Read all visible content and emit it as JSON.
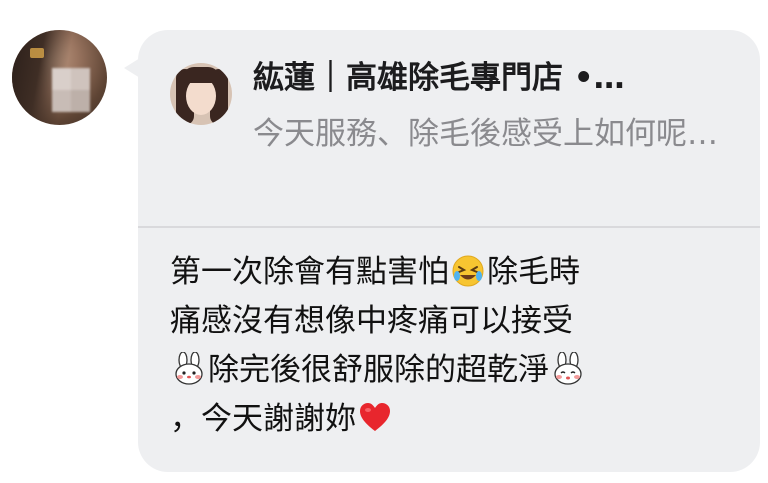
{
  "sender": {
    "avatar_icon": "blurred-profile-photo"
  },
  "quote": {
    "title": "紘蓮｜高雄除毛專門店 •…",
    "text": "今天服務、除毛後感受上如何呢…"
  },
  "message": {
    "line1_a": "第一次除會有點害怕",
    "line1_b": "除毛時",
    "line2": "痛感沒有想像中疼痛可以接受",
    "line3_a": "除完後很舒服除的超乾淨",
    "line4_a": "，今天謝謝妳",
    "emoji_laugh": "rolling-laughing-emoji",
    "emoji_bunny": "bunny-sticker-emoji",
    "emoji_heart": "red-heart-emoji"
  },
  "colors": {
    "bubble": "#eeeff1",
    "quote_text": "#8a8a8e",
    "heart": "#e8262d"
  }
}
